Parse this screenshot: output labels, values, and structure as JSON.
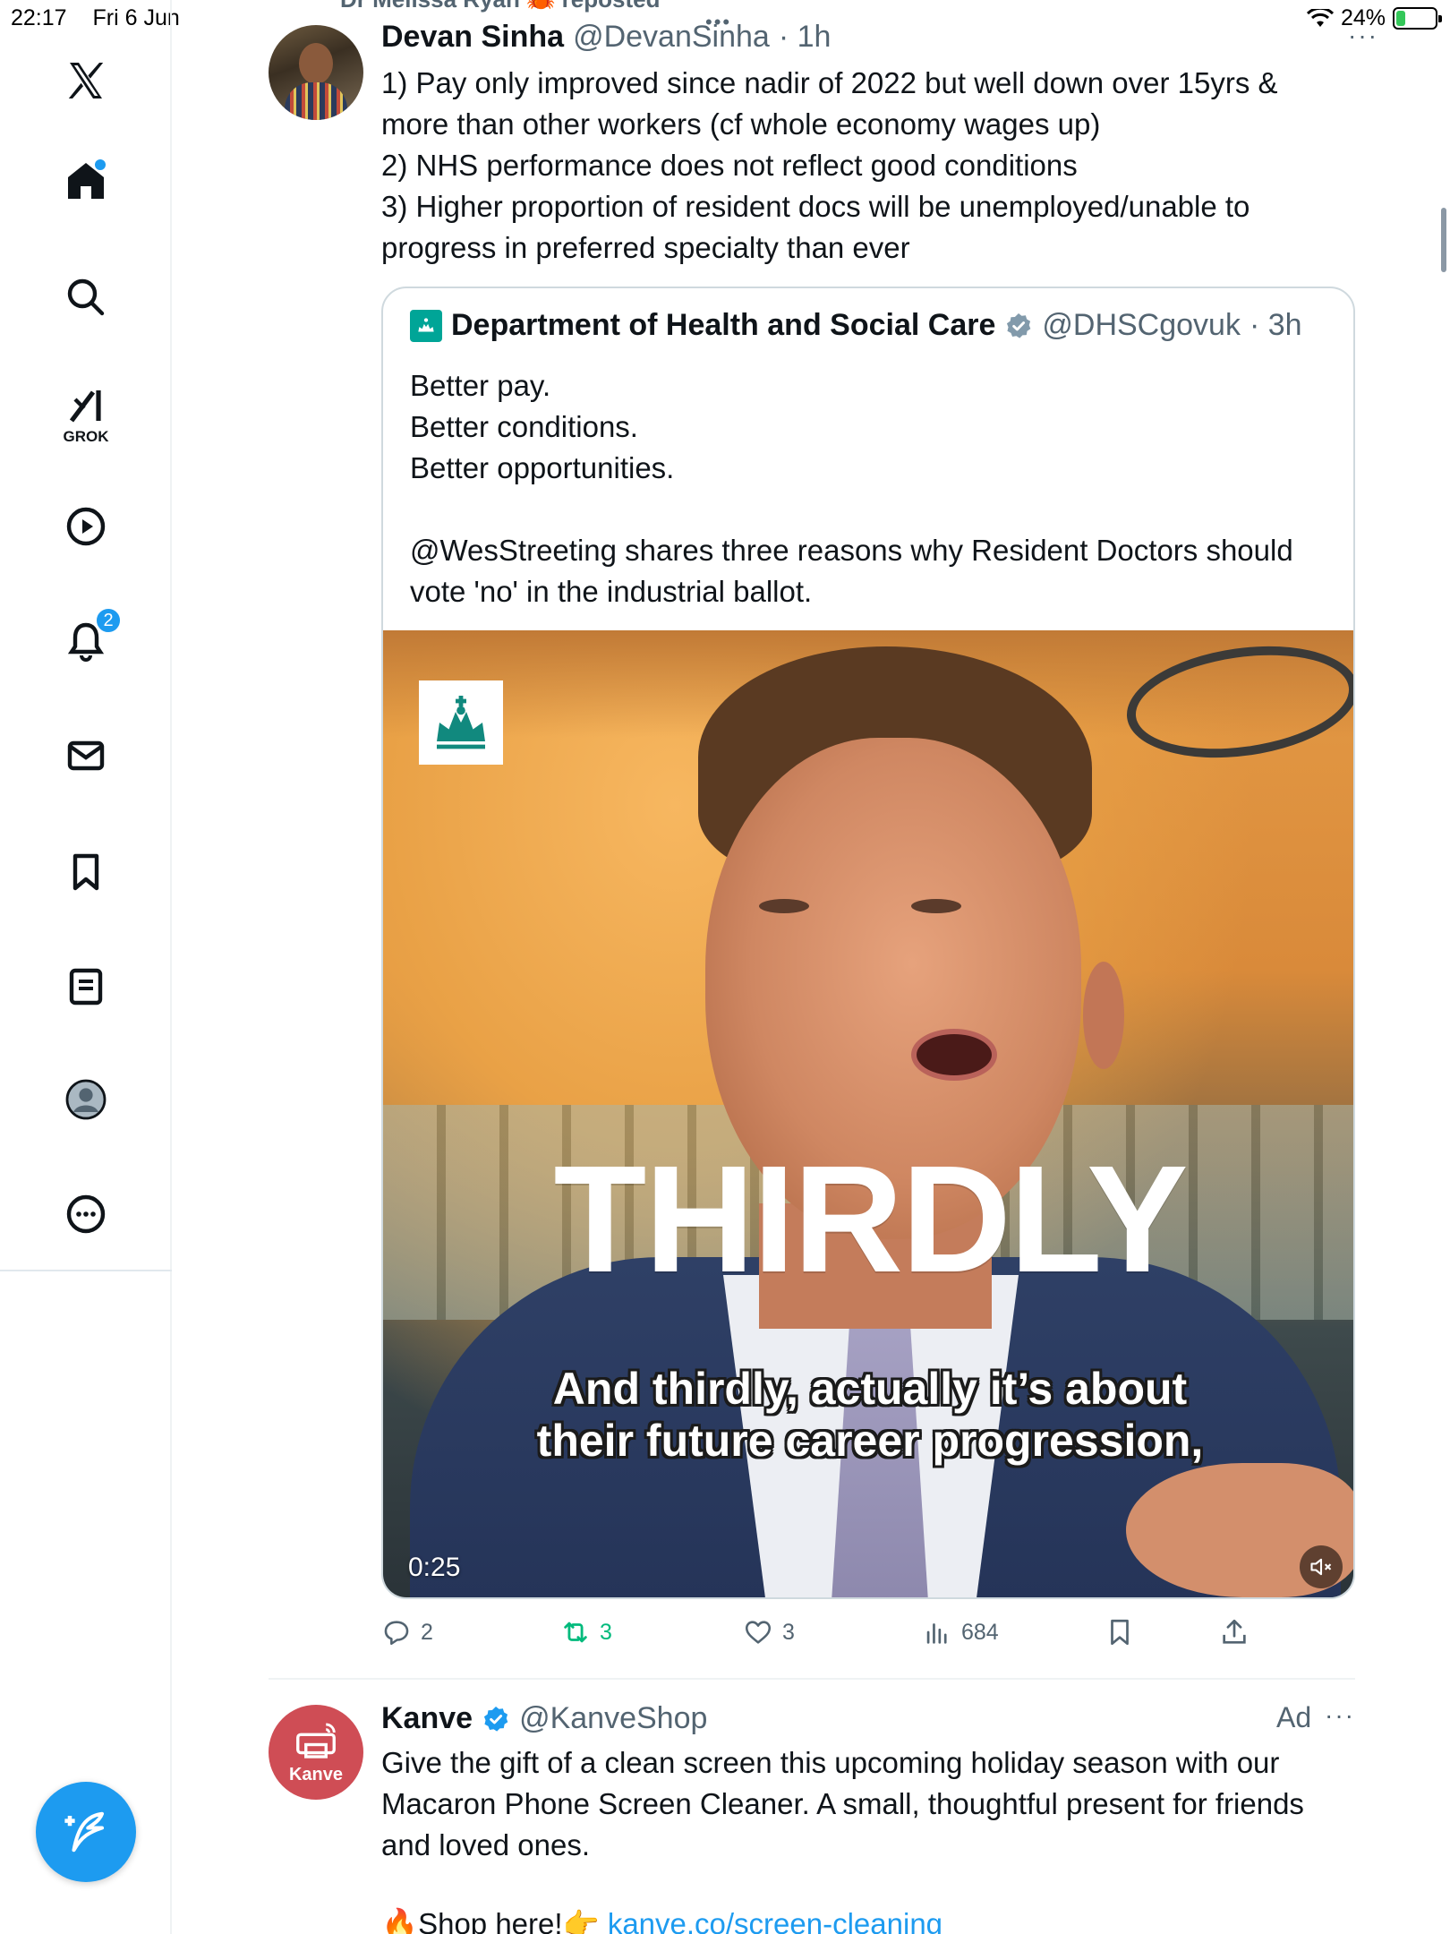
{
  "status_bar": {
    "time": "22:17",
    "date": "Fri 6 Jun",
    "battery": "24%",
    "battery_level": 0.24,
    "battery_color": "#34c759"
  },
  "sidebar": {
    "items": [
      {
        "name": "x-logo-icon"
      },
      {
        "name": "home-icon",
        "has_dot": true
      },
      {
        "name": "search-icon"
      },
      {
        "name": "grok-icon",
        "label": "GROK"
      },
      {
        "name": "video-icon"
      },
      {
        "name": "notifications-icon",
        "badge": "2"
      },
      {
        "name": "messages-icon"
      },
      {
        "name": "bookmarks-icon"
      },
      {
        "name": "lists-icon"
      },
      {
        "name": "profile-icon"
      },
      {
        "name": "more-icon"
      }
    ],
    "compose_icon": "compose-icon"
  },
  "accent_color": "#1d9bf0",
  "tweet1": {
    "repost_text": "Dr Melissa Ryan 🦀 reposted",
    "name": "Devan Sinha",
    "handle": "@DevanSinha",
    "time": "· 1h",
    "body": "1) Pay only improved since nadir of 2022 but well down over 15yrs &\nmore than other workers (cf whole economy wages up)\n2) NHS performance does not reflect good conditions\n3) Higher proportion of resident docs will be unemployed/unable to\nprogress in preferred specialty than ever",
    "quote": {
      "name": "Department of Health and Social Care",
      "handle": "@DHSCgovuk",
      "time": "· 3h",
      "body": "Better pay.\nBetter conditions.\nBetter opportunities.\n\n@WesStreeting shares three reasons why Resident Doctors should\nvote 'no' in the industrial ballot.",
      "logo_color": "#00a597",
      "video": {
        "big_caption": "THIRDLY",
        "caption_line1": "And thirdly, actually it’s about",
        "caption_line2": "their future career progression,",
        "duration": "0:25"
      }
    },
    "stats": {
      "replies": "2",
      "reposts": "3",
      "likes": "3",
      "views": "684"
    },
    "repost_color": "#00ba7c"
  },
  "tweet2": {
    "name": "Kanve",
    "handle": "@KanveShop",
    "avatar_label": "Kanve",
    "avatar_color": "#cf4d55",
    "ad_label": "Ad",
    "body": "Give the gift of a clean screen this upcoming holiday season with our\nMacaron Phone Screen Cleaner. A small, thoughtful present for friends\nand loved ones.",
    "cta_text": "🔥Shop here!👉 ",
    "cta_link": "kanve.co/screen-cleaning"
  }
}
